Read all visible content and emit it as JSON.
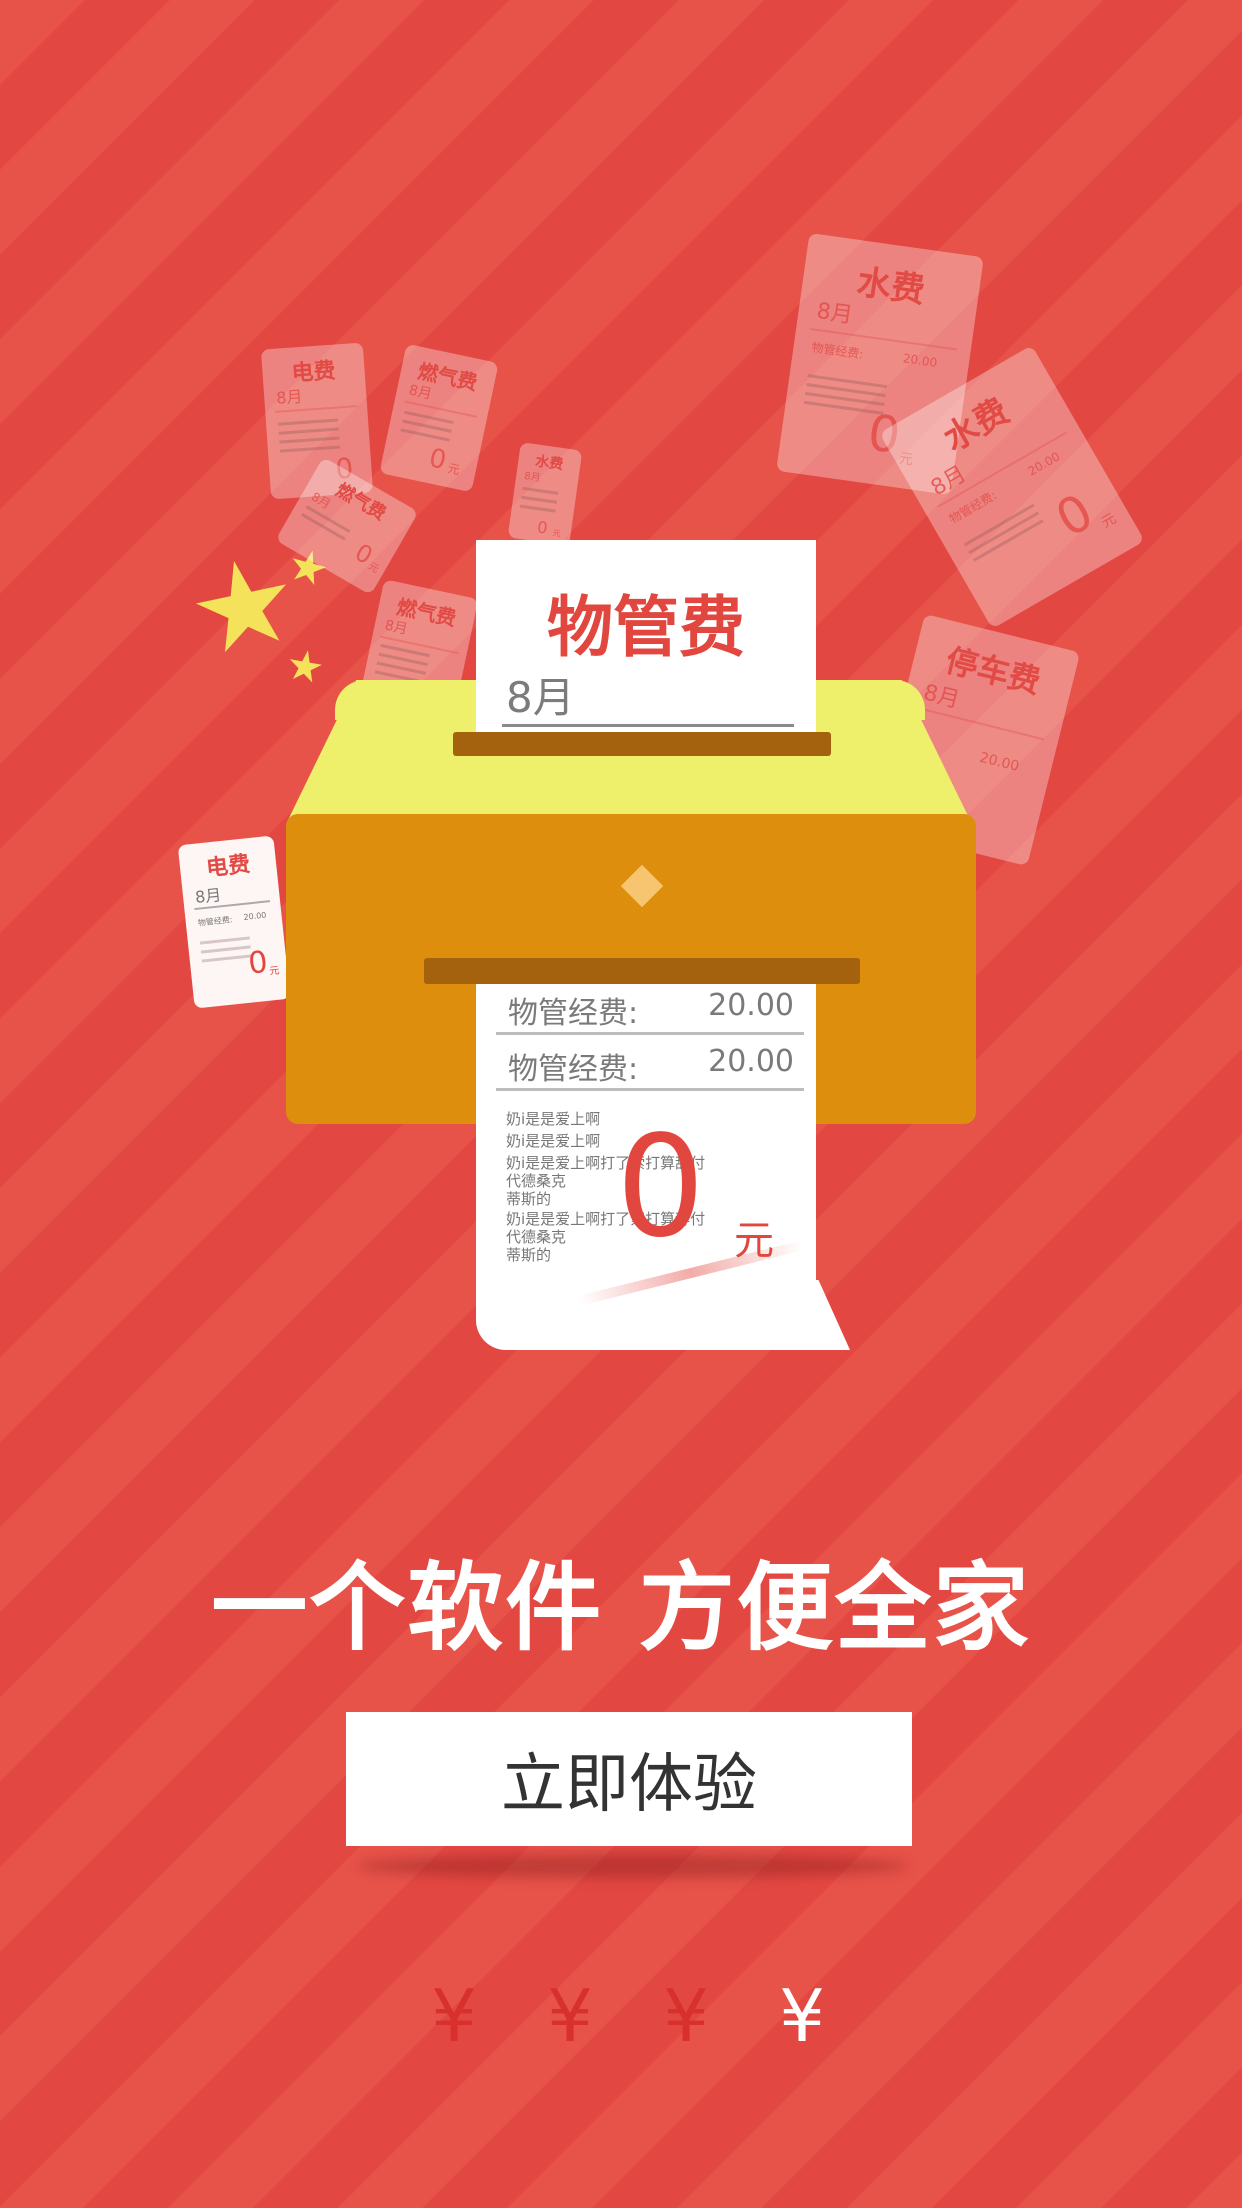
{
  "colors": {
    "background": "#e54b45",
    "accent_red": "#e2473f",
    "box_lid": "#eef06b",
    "box_body": "#dc8e0c",
    "slot": "#a4610e",
    "star": "#f3e25a"
  },
  "floating_bills": [
    {
      "title": "电费",
      "month": "8月",
      "amount": "0",
      "unit": "元"
    },
    {
      "title": "燃气费",
      "month": "8月",
      "amount": "0",
      "unit": "元"
    },
    {
      "title": "水费",
      "month": "8月",
      "amount": "0",
      "unit": "元"
    },
    {
      "title": "燃气费",
      "month": "8月",
      "amount": "0",
      "unit": "元"
    },
    {
      "title": "燃气费",
      "month": "8月",
      "amount": "",
      "unit": ""
    },
    {
      "title": "水费",
      "month": "8月",
      "amount": "0",
      "unit": "元",
      "row_label": "物管经费:",
      "row_value": "20.00"
    },
    {
      "title": "水费",
      "month": "8月",
      "amount": "0",
      "unit": "元",
      "row_label": "物管经费:",
      "row_value": "20.00"
    },
    {
      "title": "停车费",
      "month": "8月",
      "amount": "",
      "unit": "",
      "row_value": "20.00"
    },
    {
      "title": "电费",
      "month": "8月",
      "amount": "0",
      "unit": "元",
      "row_label": "物管经费:",
      "row_value": "20.00"
    }
  ],
  "top_card": {
    "title": "物管费",
    "month": "8月"
  },
  "receipt": {
    "rows": [
      {
        "label": "物管经费:",
        "value": "20.00"
      },
      {
        "label": "物管经费:",
        "value": "20.00"
      }
    ],
    "notes": [
      "奶i是是爱上啊",
      "奶i是是爱上啊",
      "奶i是是爱上啊打了索打算辞付",
      "代德桑克",
      "蒂斯的",
      "奶i是是爱上啊打了索打算辞付",
      "代德桑克",
      "蒂斯的"
    ],
    "amount": "0",
    "unit": "元"
  },
  "slogan": "一个软件 方便全家",
  "cta_label": "立即体验",
  "pager": {
    "symbol": "¥",
    "count": 4,
    "active_index": 3,
    "active_color": "#ffffff",
    "inactive_color": "#d8302c"
  }
}
